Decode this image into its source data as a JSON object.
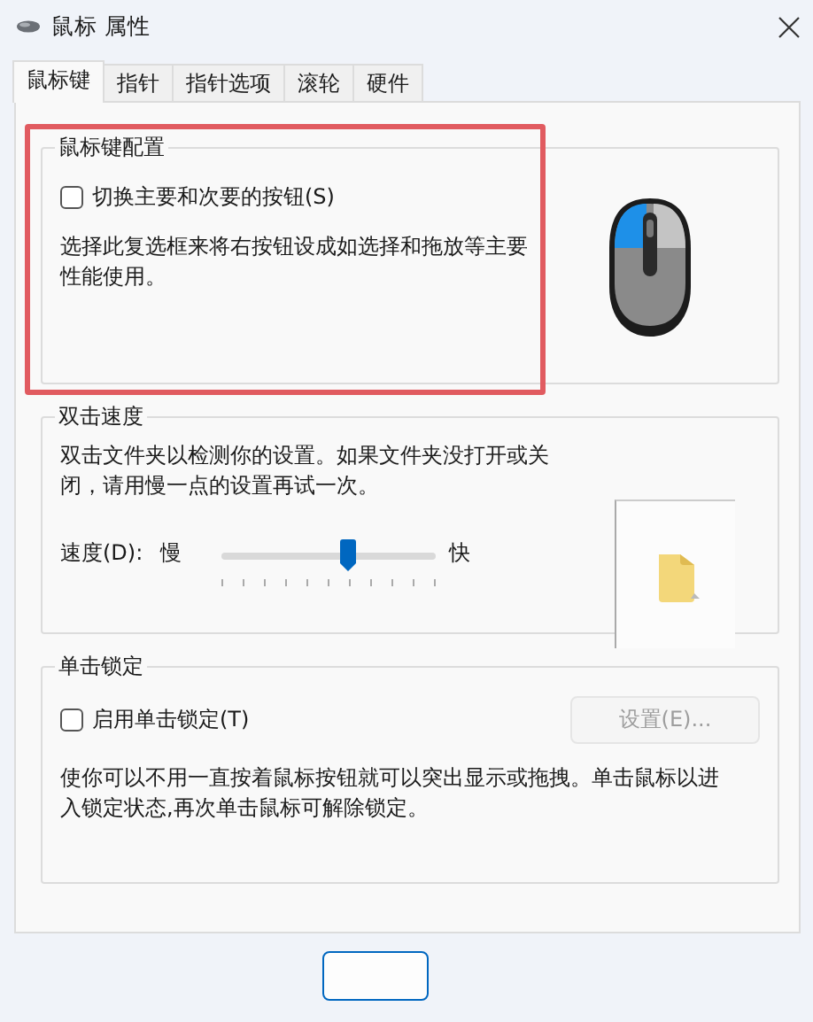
{
  "window": {
    "title": "鼠标 属性"
  },
  "tabs": [
    {
      "label": "鼠标键",
      "selected": true
    },
    {
      "label": "指针",
      "selected": false
    },
    {
      "label": "指针选项",
      "selected": false
    },
    {
      "label": "滚轮",
      "selected": false
    },
    {
      "label": "硬件",
      "selected": false
    }
  ],
  "button_config": {
    "title": "鼠标键配置",
    "highlighted": true,
    "checkbox": {
      "label": "切换主要和次要的按钮(S)",
      "checked": false
    },
    "description": "选择此复选框来将右按钮设成如选择和拖放等主要性能使用。"
  },
  "double_click": {
    "title": "双击速度",
    "description": "双击文件夹以检测你的设置。如果文件夹没打开或关闭，请用慢一点的设置再试一次。",
    "speed_label": "速度(D):",
    "slow_label": "慢",
    "fast_label": "快",
    "level": 0.59
  },
  "click_lock": {
    "title": "单击锁定",
    "checkbox": {
      "label": "启用单击锁定(T)",
      "checked": false
    },
    "settings_button": {
      "label": "设置(E)...",
      "disabled": true
    },
    "description": "使你可以不用一直按着鼠标按钮就可以突出显示或拖拽。单击鼠标以进入锁定状态,再次单击鼠标可解除锁定。"
  }
}
